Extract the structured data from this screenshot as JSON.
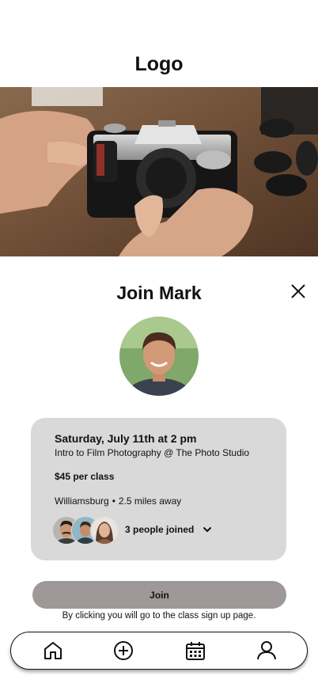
{
  "header": {
    "logo": "Logo"
  },
  "hero": {
    "image": "film-camera-in-hands-photo"
  },
  "host": {
    "title": "Join Mark",
    "avatar": "host-portrait"
  },
  "event": {
    "date": "Saturday, July 11th at 2 pm",
    "class_name": "Intro to Film Photography @ The Photo Studio",
    "price": "$45 per class",
    "location": "Williamsburg",
    "separator": "•",
    "distance": "2.5 miles away",
    "joined": "3 people joined"
  },
  "actions": {
    "join_label": "Join",
    "note": "By clicking you will go to the class sign up page."
  },
  "nav": {
    "items": [
      "home-icon",
      "add-icon",
      "calendar-icon",
      "profile-icon"
    ]
  },
  "colors": {
    "card_bg": "#d9d9d9",
    "button_bg": "#9e9898"
  }
}
